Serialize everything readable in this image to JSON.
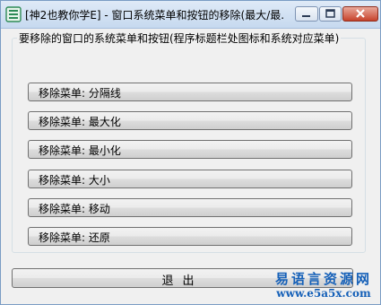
{
  "window": {
    "title": "[神2也教你学E] - 窗口系统菜单和按钮的移除(最大/最..."
  },
  "group": {
    "label": "要移除的窗口的系统菜单和按钮(程序标题栏处图标和系统对应菜单)"
  },
  "buttons": [
    {
      "label": "移除菜单: 分隔线"
    },
    {
      "label": "移除菜单: 最大化"
    },
    {
      "label": "移除菜单: 最小化"
    },
    {
      "label": "移除菜单: 大小"
    },
    {
      "label": "移除菜单: 移动"
    },
    {
      "label": "移除菜单: 还原"
    }
  ],
  "exit": {
    "label": "退出"
  },
  "watermark": {
    "name": "易语言资源网",
    "url": "www.e5a5x.com"
  },
  "colors": {
    "watermark": "#1560b8",
    "close_button": "#c7432c"
  }
}
